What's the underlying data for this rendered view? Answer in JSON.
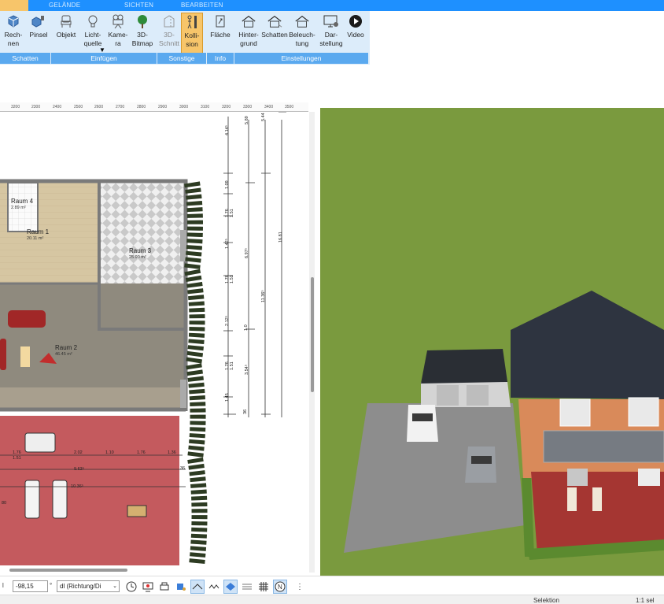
{
  "ribbon": {
    "tabs": [
      "GELÄNDE",
      "SICHTEN",
      "BEARBEITEN"
    ],
    "buttons": {
      "rechnen": "Rech-\nnen",
      "pinsel": "Pinsel",
      "objekt": "Objekt",
      "lichtquelle": "Licht-\nquelle",
      "kamera": "Kame-\nra",
      "bitmap3d": "3D-\nBitmap",
      "schnitt3d": "3D-\nSchnitt",
      "kollision": "Kolli-\nsion",
      "flaeche": "Fläche",
      "hintergrund": "Hinter-\ngrund",
      "schatten": "Schatten",
      "beleuchtung": "Beleuch-\ntung",
      "darstellung": "Dar-\nstellung",
      "video": "Video"
    },
    "groups": [
      "Schatten",
      "Einfügen",
      "Sonstige",
      "Info",
      "Einstellungen"
    ]
  },
  "plan": {
    "ruler_ticks": [
      "3200",
      "2300",
      "2400",
      "2500",
      "2600",
      "2700",
      "2800",
      "2900",
      "3000",
      "3100",
      "3200",
      "3300",
      "3400",
      "3500"
    ],
    "rooms": [
      {
        "name": "Raum 4",
        "area": "2.89 m²"
      },
      {
        "name": "Raum 1",
        "area": "20.11 m²"
      },
      {
        "name": "Raum 3",
        "area": "25.90 m²"
      },
      {
        "name": "Raum 2",
        "area": "46.45 m²"
      }
    ],
    "dims_vertical": [
      "4.14⁵",
      "5.89",
      "5.44",
      "1.09",
      "1.76",
      "1.51",
      "1.42⁵",
      "6.97⁵",
      "16.81",
      "1.76",
      "1.51",
      "11.36⁵",
      "2.12⁵",
      "1.0",
      "1.76",
      "1.51",
      "3.54⁵",
      "1.45",
      "36"
    ],
    "dims_horizontal": [
      "1.76",
      "1.51",
      "2.02",
      "1.10",
      "1.76",
      "1.36",
      "9.63⁵",
      "10.36⁵",
      "36",
      "80"
    ]
  },
  "bottom": {
    "angle_label": "l",
    "angle_value": "-98,15",
    "angle_unit": "°",
    "direction": "dl (Richtung/Di"
  },
  "status": {
    "mode": "Selektion",
    "selection": "1:1 sel"
  }
}
